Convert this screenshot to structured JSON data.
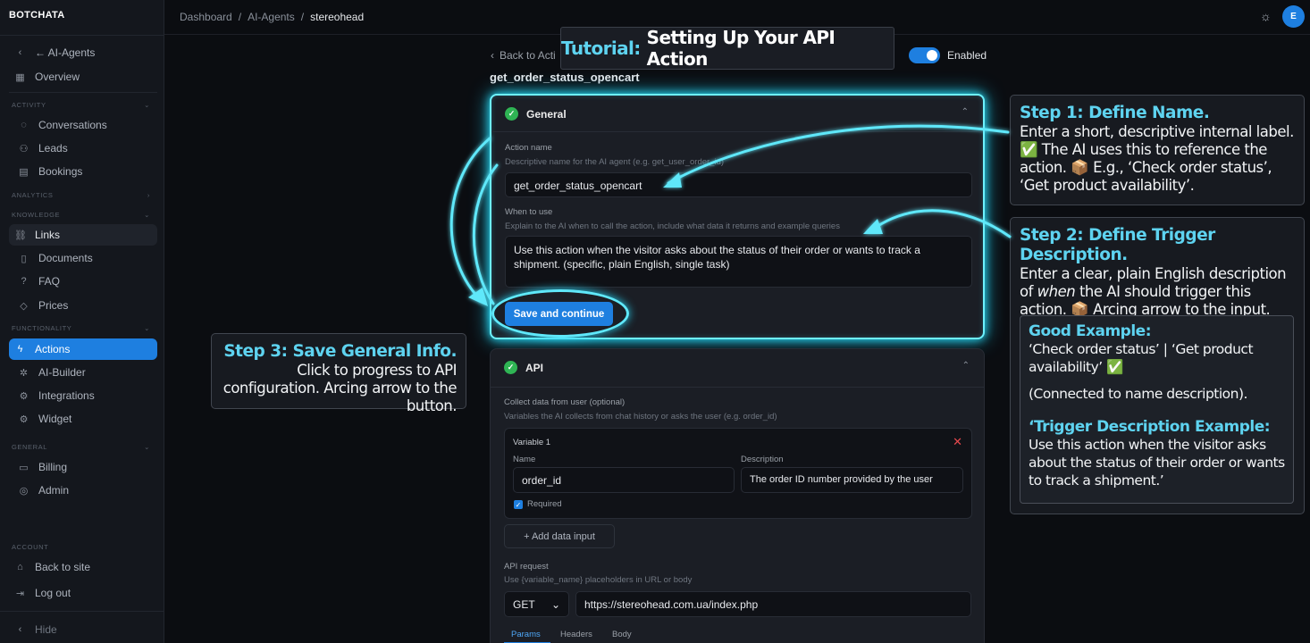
{
  "brand": "BOTCHATA",
  "breadcrumb": [
    "Dashboard",
    "AI-Agents",
    "stereohead"
  ],
  "sidebar": {
    "back_label": "← AI-Agents",
    "overview": "Overview",
    "sections": {
      "activity": "ACTIVITY",
      "analytics": "ANALYTICS",
      "knowledge": "KNOWLEDGE",
      "functionality": "FUNCTIONALITY",
      "general": "GENERAL",
      "account": "ACCOUNT"
    },
    "activity_items": [
      "Conversations",
      "Leads",
      "Bookings"
    ],
    "knowledge_items": [
      "Links",
      "Documents",
      "FAQ",
      "Prices"
    ],
    "functionality_items": [
      "Actions",
      "AI-Builder",
      "Integrations",
      "Widget"
    ],
    "general_items": [
      "Billing",
      "Admin"
    ],
    "account_items": [
      "Back to site",
      "Log out"
    ],
    "hide": "Hide"
  },
  "header": {
    "back": "Back to Acti",
    "enabled_label": "Enabled",
    "enabled": true,
    "action_title": "get_order_status_opencart"
  },
  "tutorial": {
    "prefix": "Tutorial:",
    "title": "Setting Up Your API Action"
  },
  "general": {
    "title": "General",
    "action_name_label": "Action name",
    "action_name_hint": "Descriptive name for the AI agent (e.g. get_user_order_id)",
    "action_name_value": "get_order_status_opencart",
    "when_label": "When to use",
    "when_hint": "Explain to the AI when to call the action, include what data it returns and example queries",
    "when_value": "Use this action when the visitor asks about the status of their order or wants to track a shipment. (specific, plain English, single task)",
    "save_button": "Save and continue"
  },
  "api": {
    "title": "API",
    "collect_label": "Collect data from user (optional)",
    "collect_hint": "Variables the AI collects from chat history or asks the user (e.g. order_id)",
    "variable_title": "Variable 1",
    "name_label": "Name",
    "desc_label": "Description",
    "name_value": "order_id",
    "desc_value": "The order ID number provided by the user",
    "required_label": "Required",
    "add_input": "+ Add data input",
    "request_label": "API request",
    "request_hint": "Use {variable_name} placeholders in URL or body",
    "method": "GET",
    "url": "https://stereohead.com.ua/index.php",
    "tabs": [
      "Params",
      "Headers",
      "Body"
    ]
  },
  "callouts": {
    "step1_title": "Step 1: Define Name.",
    "step1_body": "Enter a short, descriptive internal label. ✅ The AI uses this to reference the action. 📦 E.g., ‘Check order status’, ‘Get product availability’.",
    "step2_title": "Step 2: Define Trigger Description.",
    "step2_body_pre": "Enter a clear, plain English description of ",
    "step2_body_em": "when",
    "step2_body_post": " the AI should trigger this action. 📦 Arcing arrow to the input.",
    "good_title": "Good Example:",
    "good_body": "‘Check order status’ | ‘Get product availability’ ✅",
    "good_note": "(Connected to name description).",
    "trigger_title": "‘Trigger Description Example:",
    "trigger_body": "Use this action when the visitor asks about the status of their order or wants to track a shipment.’",
    "step3_title": "Step 3: Save General Info.",
    "step3_body": "Click to progress to API configuration. Arcing arrow to the button."
  },
  "colors": {
    "accent_blue": "#1e7fe0",
    "highlight_cyan": "#5ed3f0",
    "success_green": "#2fb454",
    "close_red": "#e5484d"
  },
  "icons": [
    "chevron-left-icon",
    "grid-icon",
    "chat-icon",
    "users-icon",
    "calendar-icon",
    "link-icon",
    "document-icon",
    "faq-icon",
    "tag-icon",
    "bolt-icon",
    "builder-icon",
    "integrations-icon",
    "widget-icon",
    "billing-icon",
    "admin-icon",
    "home-icon",
    "logout-icon",
    "sun-icon",
    "check-circle-icon",
    "chevron-up-icon",
    "close-icon",
    "chevron-down-icon"
  ]
}
